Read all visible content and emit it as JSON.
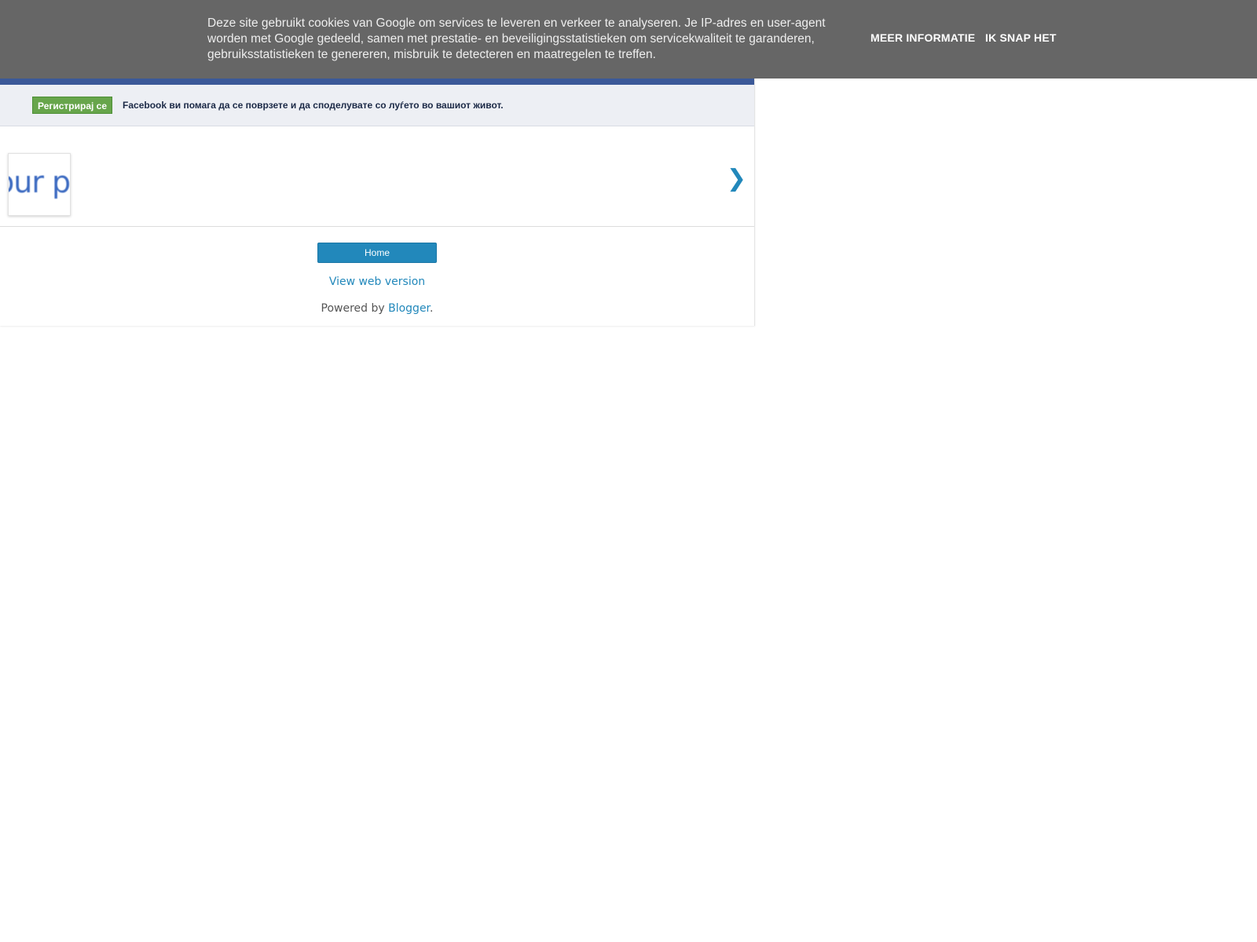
{
  "cookie_notice": {
    "text": "Deze site gebruikt cookies van Google om services te leveren en verkeer te analyseren. Je IP-adres en user-agent worden met Google gedeeld, samen met prestatie- en beveiligingsstatistieken om servicekwaliteit te garanderen, gebruiksstatistieken te genereren, misbruik te detecteren en maatregelen te treffen.",
    "more_info_label": "MEER INFORMATIE",
    "accept_label": "IK SNAP HET"
  },
  "facebook_banner": {
    "register_label": "Регистрирај се",
    "tagline": "Facebook ви помага да се поврзете и да споделувате со луѓето во вашиот живот."
  },
  "slider": {
    "thumbnail_text": "our p",
    "next_glyph": "❯"
  },
  "footer": {
    "home_label": "Home",
    "web_version_label": "View web version",
    "powered_prefix": "Powered by ",
    "powered_link": "Blogger",
    "powered_suffix": "."
  },
  "colors": {
    "cookie_bar": "#666666",
    "facebook_blue": "#3b5998",
    "facebook_strip": "#edeff4",
    "register_green": "#67a54b",
    "blogger_link": "#2288bb"
  }
}
